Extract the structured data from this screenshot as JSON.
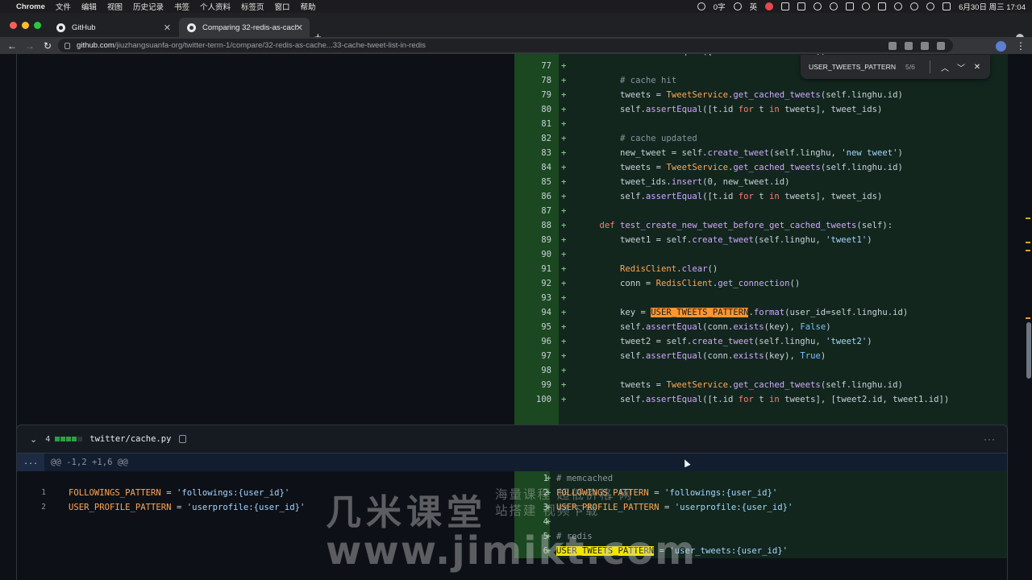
{
  "menubar": {
    "app": "Chrome",
    "items": [
      "文件",
      "编辑",
      "视图",
      "历史记录",
      "书签",
      "个人资料",
      "标签页",
      "窗口",
      "帮助"
    ],
    "right_text": "0字",
    "ime": "英",
    "datetime": "6月30日 周三  17:04"
  },
  "tabs": [
    {
      "label": "GitHub"
    },
    {
      "label": "Comparing 32-redis-as-cache"
    }
  ],
  "omnibox": {
    "host": "github.com",
    "path": "/jiuzhangsuanfa-org/twitter-term-1/compare/32-redis-as-cache...33-cache-tweet-list-in-redis"
  },
  "findbar": {
    "query": "USER_TWEETS_PATTERN",
    "count": "5/6"
  },
  "diff1": {
    "lines": [
      {
        "n": "76",
        "tokens": [
          [
            "        ",
            ""
          ],
          [
            "self",
            "fn"
          ],
          [
            ".",
            ""
          ],
          [
            "assertEqual",
            "fn"
          ],
          [
            "([t.id ",
            ""
          ],
          [
            "for",
            "kw"
          ],
          [
            " t ",
            ""
          ],
          [
            "in",
            "kw"
          ],
          [
            " tweets], t",
            ""
          ]
        ]
      },
      {
        "n": "77",
        "tokens": []
      },
      {
        "n": "78",
        "tokens": [
          [
            "        ",
            ""
          ],
          [
            "# cache hit",
            "cm"
          ]
        ]
      },
      {
        "n": "79",
        "tokens": [
          [
            "        tweets = ",
            ""
          ],
          [
            "TweetService",
            "cls"
          ],
          [
            ".",
            ""
          ],
          [
            "get_cached_tweets",
            "fn"
          ],
          [
            "(self.linghu.id)",
            ""
          ]
        ]
      },
      {
        "n": "80",
        "tokens": [
          [
            "        self.",
            ""
          ],
          [
            "assertEqual",
            "fn"
          ],
          [
            "([t.id ",
            ""
          ],
          [
            "for",
            "kw"
          ],
          [
            " t ",
            ""
          ],
          [
            "in",
            "kw"
          ],
          [
            " tweets], tweet_ids)",
            ""
          ]
        ]
      },
      {
        "n": "81",
        "tokens": []
      },
      {
        "n": "82",
        "tokens": [
          [
            "        ",
            ""
          ],
          [
            "# cache updated",
            "cm"
          ]
        ]
      },
      {
        "n": "83",
        "tokens": [
          [
            "        new_tweet = self.",
            ""
          ],
          [
            "create_tweet",
            "fn"
          ],
          [
            "(self.linghu, ",
            ""
          ],
          [
            "'new tweet'",
            "str"
          ],
          [
            ")",
            ""
          ]
        ]
      },
      {
        "n": "84",
        "tokens": [
          [
            "        tweets = ",
            ""
          ],
          [
            "TweetService",
            "cls"
          ],
          [
            ".",
            ""
          ],
          [
            "get_cached_tweets",
            "fn"
          ],
          [
            "(self.linghu.id)",
            ""
          ]
        ]
      },
      {
        "n": "85",
        "tokens": [
          [
            "        tweet_ids.",
            ""
          ],
          [
            "insert",
            "fn"
          ],
          [
            "(0, new_tweet.id)",
            ""
          ]
        ]
      },
      {
        "n": "86",
        "tokens": [
          [
            "        self.",
            ""
          ],
          [
            "assertEqual",
            "fn"
          ],
          [
            "([t.id ",
            ""
          ],
          [
            "for",
            "kw"
          ],
          [
            " t ",
            ""
          ],
          [
            "in",
            "kw"
          ],
          [
            " tweets], tweet_ids)",
            ""
          ]
        ]
      },
      {
        "n": "87",
        "tokens": []
      },
      {
        "n": "88",
        "tokens": [
          [
            "    ",
            ""
          ],
          [
            "def",
            "kw"
          ],
          [
            " ",
            ""
          ],
          [
            "test_create_new_tweet_before_get_cached_tweets",
            "fn"
          ],
          [
            "(self):",
            ""
          ]
        ]
      },
      {
        "n": "89",
        "tokens": [
          [
            "        tweet1 = self.",
            ""
          ],
          [
            "create_tweet",
            "fn"
          ],
          [
            "(self.linghu, ",
            ""
          ],
          [
            "'tweet1'",
            "str"
          ],
          [
            ")",
            ""
          ]
        ]
      },
      {
        "n": "90",
        "tokens": []
      },
      {
        "n": "91",
        "tokens": [
          [
            "        ",
            ""
          ],
          [
            "RedisClient",
            "cls"
          ],
          [
            ".",
            ""
          ],
          [
            "clear",
            "fn"
          ],
          [
            "()",
            ""
          ]
        ]
      },
      {
        "n": "92",
        "tokens": [
          [
            "        conn = ",
            ""
          ],
          [
            "RedisClient",
            "cls"
          ],
          [
            ".",
            ""
          ],
          [
            "get_connection",
            "fn"
          ],
          [
            "()",
            ""
          ]
        ]
      },
      {
        "n": "93",
        "tokens": []
      },
      {
        "n": "94",
        "tokens": [
          [
            "        key = ",
            ""
          ],
          [
            "USER_TWEETS_PATTERN",
            "hl-orange"
          ],
          [
            ".",
            ""
          ],
          [
            "format",
            "fn"
          ],
          [
            "(user_id=self.linghu.id)",
            ""
          ]
        ]
      },
      {
        "n": "95",
        "tokens": [
          [
            "        self.",
            ""
          ],
          [
            "assertEqual",
            "fn"
          ],
          [
            "(conn.",
            ""
          ],
          [
            "exists",
            "fn"
          ],
          [
            "(key), ",
            ""
          ],
          [
            "False",
            "bi"
          ],
          [
            ")",
            ""
          ]
        ]
      },
      {
        "n": "96",
        "tokens": [
          [
            "        tweet2 = self.",
            ""
          ],
          [
            "create_tweet",
            "fn"
          ],
          [
            "(self.linghu, ",
            ""
          ],
          [
            "'tweet2'",
            "str"
          ],
          [
            ")",
            ""
          ]
        ]
      },
      {
        "n": "97",
        "tokens": [
          [
            "        self.",
            ""
          ],
          [
            "assertEqual",
            "fn"
          ],
          [
            "(conn.",
            ""
          ],
          [
            "exists",
            "fn"
          ],
          [
            "(key), ",
            ""
          ],
          [
            "True",
            "bi"
          ],
          [
            ")",
            ""
          ]
        ]
      },
      {
        "n": "98",
        "tokens": []
      },
      {
        "n": "99",
        "tokens": [
          [
            "        tweets = ",
            ""
          ],
          [
            "TweetService",
            "cls"
          ],
          [
            ".",
            ""
          ],
          [
            "get_cached_tweets",
            "fn"
          ],
          [
            "(self.linghu.id)",
            ""
          ]
        ]
      },
      {
        "n": "100",
        "tokens": [
          [
            "        self.",
            ""
          ],
          [
            "assertEqual",
            "fn"
          ],
          [
            "([t.id ",
            ""
          ],
          [
            "for",
            "kw"
          ],
          [
            " t ",
            ""
          ],
          [
            "in",
            "kw"
          ],
          [
            " tweets], [tweet2.id, tweet1.id])",
            ""
          ]
        ]
      }
    ]
  },
  "file2": {
    "count": "4",
    "name": "twitter/cache.py",
    "hunk": "@@ -1,2 +1,6 @@",
    "expand": "...",
    "left": [
      {
        "n": "1",
        "tokens": [
          [
            "FOLLOWINGS_PATTERN",
            "cls"
          ],
          [
            " = ",
            ""
          ],
          [
            "'followings:{user_id}'",
            "str"
          ]
        ]
      },
      {
        "n": "2",
        "tokens": [
          [
            "USER_PROFILE_PATTERN",
            "cls"
          ],
          [
            " = ",
            ""
          ],
          [
            "'userprofile:{user_id}'",
            "str"
          ]
        ]
      }
    ],
    "right": [
      {
        "n": "1",
        "tokens": [
          [
            "# memcached",
            "cm"
          ]
        ]
      },
      {
        "n": "2",
        "tokens": [
          [
            "FOLLOWINGS_PATTERN",
            "cls"
          ],
          [
            " = ",
            ""
          ],
          [
            "'followings:{user_id}'",
            "str"
          ]
        ]
      },
      {
        "n": "3",
        "tokens": [
          [
            "USER_PROFILE_PATTERN",
            "cls"
          ],
          [
            " = ",
            ""
          ],
          [
            "'userprofile:{user_id}'",
            "str"
          ]
        ]
      },
      {
        "n": "4",
        "tokens": []
      },
      {
        "n": "5",
        "tokens": [
          [
            "# redis",
            "cm"
          ]
        ]
      },
      {
        "n": "6",
        "tokens": [
          [
            "USER_TWEETS_PATTERN",
            "hl-yellow"
          ],
          [
            " = ",
            ""
          ],
          [
            "'user_tweets:{user_id}'",
            "str"
          ]
        ]
      }
    ]
  },
  "watermark": {
    "cn": "几米课堂",
    "sub": "海量课程 超低价格 网站搭建 视频下载",
    "url": "www.jimikt.com"
  }
}
